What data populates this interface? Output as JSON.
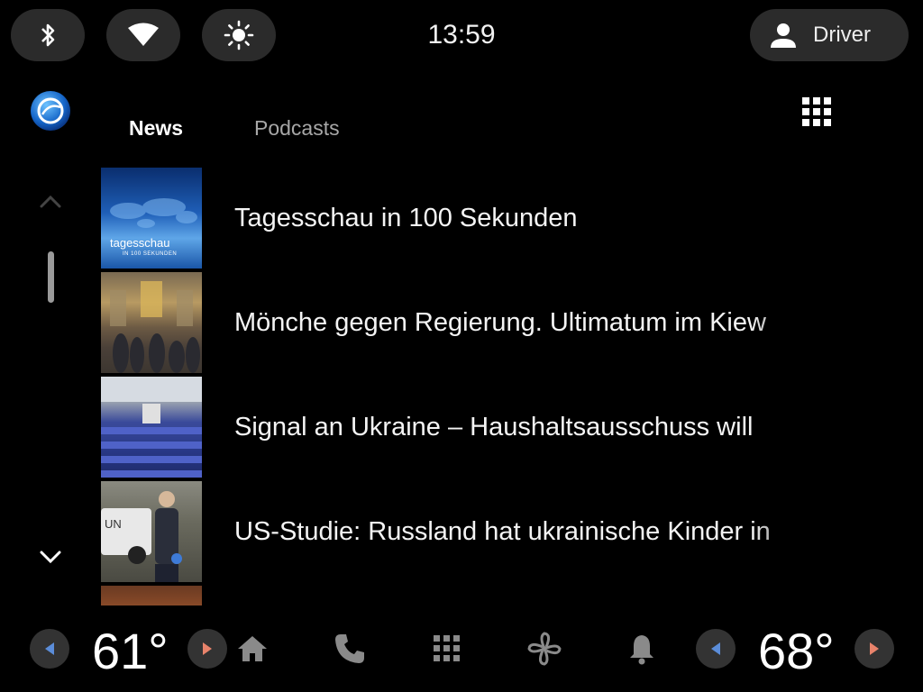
{
  "status_bar": {
    "clock": "13:59",
    "profile_label": "Driver",
    "icons": [
      "bluetooth-icon",
      "wifi-icon",
      "brightness-icon",
      "person-icon"
    ]
  },
  "app": {
    "logo_icon": "tagesschau-logo",
    "tabs": [
      {
        "label": "News",
        "selected": true
      },
      {
        "label": "Podcasts",
        "selected": false
      }
    ],
    "browse_icon": "apps-grid-icon"
  },
  "list": {
    "items": [
      {
        "title": "Tagesschau in 100 Sekunden",
        "thumb_text": "tagesschau",
        "thumb_subtext": "IN 100 SEKUNDEN"
      },
      {
        "title": "Mönche gegen Regierung. Ultimatum im Kiew"
      },
      {
        "title": "Signal an Ukraine – Haushaltsausschuss will"
      },
      {
        "title": "US-Studie: Russland hat ukrainische Kinder in"
      },
      {
        "title": ""
      }
    ]
  },
  "climate": {
    "driver_temp": "61°",
    "passenger_temp": "68°"
  },
  "nav_bar": {
    "icons": [
      "home-icon",
      "phone-icon",
      "apps-icon",
      "fan-icon",
      "notifications-icon"
    ]
  },
  "colors": {
    "background": "#000000",
    "pill": "#2b2b2b",
    "arrow_left": "#5b8dd9",
    "arrow_right": "#e8836b"
  }
}
